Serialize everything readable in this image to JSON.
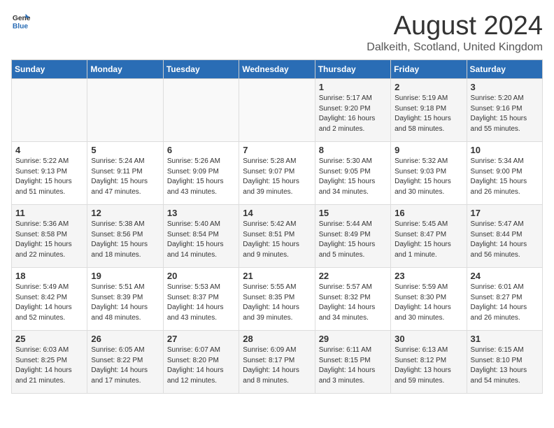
{
  "header": {
    "logo_general": "General",
    "logo_blue": "Blue",
    "month_year": "August 2024",
    "location": "Dalkeith, Scotland, United Kingdom"
  },
  "weekdays": [
    "Sunday",
    "Monday",
    "Tuesday",
    "Wednesday",
    "Thursday",
    "Friday",
    "Saturday"
  ],
  "weeks": [
    [
      {
        "day": "",
        "info": ""
      },
      {
        "day": "",
        "info": ""
      },
      {
        "day": "",
        "info": ""
      },
      {
        "day": "",
        "info": ""
      },
      {
        "day": "1",
        "info": "Sunrise: 5:17 AM\nSunset: 9:20 PM\nDaylight: 16 hours\nand 2 minutes."
      },
      {
        "day": "2",
        "info": "Sunrise: 5:19 AM\nSunset: 9:18 PM\nDaylight: 15 hours\nand 58 minutes."
      },
      {
        "day": "3",
        "info": "Sunrise: 5:20 AM\nSunset: 9:16 PM\nDaylight: 15 hours\nand 55 minutes."
      }
    ],
    [
      {
        "day": "4",
        "info": "Sunrise: 5:22 AM\nSunset: 9:13 PM\nDaylight: 15 hours\nand 51 minutes."
      },
      {
        "day": "5",
        "info": "Sunrise: 5:24 AM\nSunset: 9:11 PM\nDaylight: 15 hours\nand 47 minutes."
      },
      {
        "day": "6",
        "info": "Sunrise: 5:26 AM\nSunset: 9:09 PM\nDaylight: 15 hours\nand 43 minutes."
      },
      {
        "day": "7",
        "info": "Sunrise: 5:28 AM\nSunset: 9:07 PM\nDaylight: 15 hours\nand 39 minutes."
      },
      {
        "day": "8",
        "info": "Sunrise: 5:30 AM\nSunset: 9:05 PM\nDaylight: 15 hours\nand 34 minutes."
      },
      {
        "day": "9",
        "info": "Sunrise: 5:32 AM\nSunset: 9:03 PM\nDaylight: 15 hours\nand 30 minutes."
      },
      {
        "day": "10",
        "info": "Sunrise: 5:34 AM\nSunset: 9:00 PM\nDaylight: 15 hours\nand 26 minutes."
      }
    ],
    [
      {
        "day": "11",
        "info": "Sunrise: 5:36 AM\nSunset: 8:58 PM\nDaylight: 15 hours\nand 22 minutes."
      },
      {
        "day": "12",
        "info": "Sunrise: 5:38 AM\nSunset: 8:56 PM\nDaylight: 15 hours\nand 18 minutes."
      },
      {
        "day": "13",
        "info": "Sunrise: 5:40 AM\nSunset: 8:54 PM\nDaylight: 15 hours\nand 14 minutes."
      },
      {
        "day": "14",
        "info": "Sunrise: 5:42 AM\nSunset: 8:51 PM\nDaylight: 15 hours\nand 9 minutes."
      },
      {
        "day": "15",
        "info": "Sunrise: 5:44 AM\nSunset: 8:49 PM\nDaylight: 15 hours\nand 5 minutes."
      },
      {
        "day": "16",
        "info": "Sunrise: 5:45 AM\nSunset: 8:47 PM\nDaylight: 15 hours\nand 1 minute."
      },
      {
        "day": "17",
        "info": "Sunrise: 5:47 AM\nSunset: 8:44 PM\nDaylight: 14 hours\nand 56 minutes."
      }
    ],
    [
      {
        "day": "18",
        "info": "Sunrise: 5:49 AM\nSunset: 8:42 PM\nDaylight: 14 hours\nand 52 minutes."
      },
      {
        "day": "19",
        "info": "Sunrise: 5:51 AM\nSunset: 8:39 PM\nDaylight: 14 hours\nand 48 minutes."
      },
      {
        "day": "20",
        "info": "Sunrise: 5:53 AM\nSunset: 8:37 PM\nDaylight: 14 hours\nand 43 minutes."
      },
      {
        "day": "21",
        "info": "Sunrise: 5:55 AM\nSunset: 8:35 PM\nDaylight: 14 hours\nand 39 minutes."
      },
      {
        "day": "22",
        "info": "Sunrise: 5:57 AM\nSunset: 8:32 PM\nDaylight: 14 hours\nand 34 minutes."
      },
      {
        "day": "23",
        "info": "Sunrise: 5:59 AM\nSunset: 8:30 PM\nDaylight: 14 hours\nand 30 minutes."
      },
      {
        "day": "24",
        "info": "Sunrise: 6:01 AM\nSunset: 8:27 PM\nDaylight: 14 hours\nand 26 minutes."
      }
    ],
    [
      {
        "day": "25",
        "info": "Sunrise: 6:03 AM\nSunset: 8:25 PM\nDaylight: 14 hours\nand 21 minutes."
      },
      {
        "day": "26",
        "info": "Sunrise: 6:05 AM\nSunset: 8:22 PM\nDaylight: 14 hours\nand 17 minutes."
      },
      {
        "day": "27",
        "info": "Sunrise: 6:07 AM\nSunset: 8:20 PM\nDaylight: 14 hours\nand 12 minutes."
      },
      {
        "day": "28",
        "info": "Sunrise: 6:09 AM\nSunset: 8:17 PM\nDaylight: 14 hours\nand 8 minutes."
      },
      {
        "day": "29",
        "info": "Sunrise: 6:11 AM\nSunset: 8:15 PM\nDaylight: 14 hours\nand 3 minutes."
      },
      {
        "day": "30",
        "info": "Sunrise: 6:13 AM\nSunset: 8:12 PM\nDaylight: 13 hours\nand 59 minutes."
      },
      {
        "day": "31",
        "info": "Sunrise: 6:15 AM\nSunset: 8:10 PM\nDaylight: 13 hours\nand 54 minutes."
      }
    ]
  ]
}
